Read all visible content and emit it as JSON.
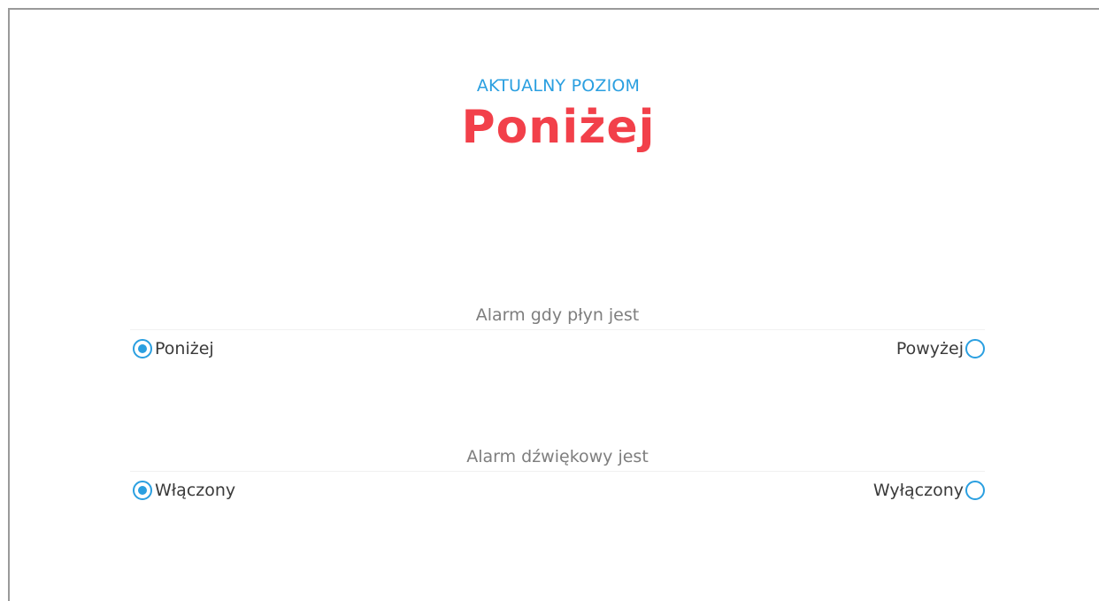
{
  "level": {
    "caption": "AKTUALNY POZIOM",
    "value": "Poniżej",
    "value_color": "#f2404a",
    "caption_color": "#2a9fe0"
  },
  "alarm_level": {
    "title": "Alarm gdy płyn jest",
    "options": [
      {
        "label": "Poniżej",
        "selected": true
      },
      {
        "label": "Powyżej",
        "selected": false
      }
    ]
  },
  "alarm_sound": {
    "title": "Alarm dźwiękowy jest",
    "options": [
      {
        "label": "Włączony",
        "selected": true
      },
      {
        "label": "Wyłączony",
        "selected": false
      }
    ]
  },
  "accent_color": "#2a9fe0"
}
